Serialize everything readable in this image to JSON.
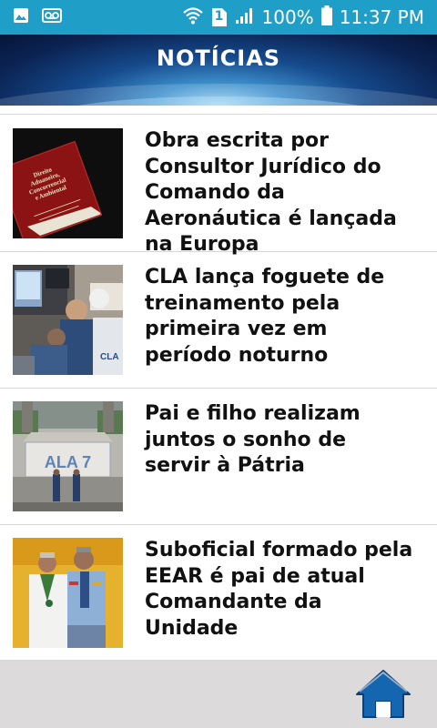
{
  "status_bar": {
    "sim_slot": "1",
    "battery_percent": "100%",
    "time": "11:37 PM",
    "icons": [
      "image-icon",
      "voicemail-icon",
      "wifi-icon",
      "sim-icon",
      "signal-icon",
      "battery-icon"
    ]
  },
  "header": {
    "title": "NOTÍCIAS"
  },
  "news": [
    {
      "title": "Obra escrita por Consultor Jurídico do Comando da Aeronáutica é lançada na Europa"
    },
    {
      "title": "CLA lança foguete de treinamento pela primeira vez em período noturno"
    },
    {
      "title": "Pai e filho realizam juntos o sonho de servir à Pátria"
    },
    {
      "title": "Suboficial formado pela EEAR é pai de atual Comandante da Unidade"
    }
  ],
  "thumbnail_lettering": {
    "book_cover": "Direito Aduaneiro, Concorrencial e Ambiental",
    "ala_sign": "ALA 7",
    "uniform_text": "CLA"
  },
  "bottom_bar": {
    "home_icon": "home-icon"
  },
  "colors": {
    "status_bar": "#1f9ec8",
    "header_dark": "#0b2353",
    "bottom_bar": "#dcdada",
    "home_icon": "#1566b0"
  }
}
